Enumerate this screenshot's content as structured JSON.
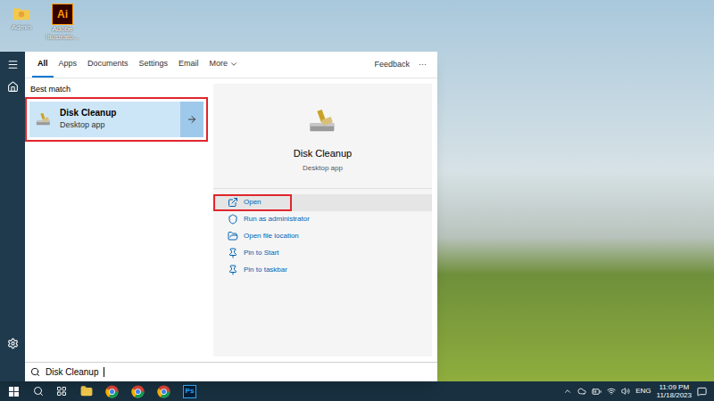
{
  "desktop": {
    "icons": [
      {
        "label": "Admin",
        "kind": "folder"
      },
      {
        "label": "Adobe Illustrato...",
        "kind": "illustrator",
        "badge": "Ai"
      }
    ]
  },
  "search_panel": {
    "tabs": [
      {
        "label": "All",
        "selected": true
      },
      {
        "label": "Apps",
        "selected": false
      },
      {
        "label": "Documents",
        "selected": false
      },
      {
        "label": "Settings",
        "selected": false
      },
      {
        "label": "Email",
        "selected": false
      },
      {
        "label": "More",
        "selected": false
      }
    ],
    "feedback": "Feedback",
    "overflow": "···"
  },
  "best_match": {
    "heading": "Best match",
    "title": "Disk Cleanup",
    "subtitle": "Desktop app",
    "selected": true,
    "annotated": true
  },
  "preview": {
    "title": "Disk Cleanup",
    "subtitle": "Desktop app"
  },
  "actions": [
    {
      "label": "Open",
      "kind": "open",
      "selected": true,
      "annotated": true
    },
    {
      "label": "Run as administrator",
      "kind": "admin",
      "selected": false,
      "annotated": false
    },
    {
      "label": "Open file location",
      "kind": "location",
      "selected": false,
      "annotated": false
    },
    {
      "label": "Pin to Start",
      "kind": "pin",
      "selected": false,
      "annotated": false
    },
    {
      "label": "Pin to taskbar",
      "kind": "pin",
      "selected": false,
      "annotated": false
    }
  ],
  "search": {
    "value": "Disk Cleanup"
  },
  "taskbar": {
    "apps": [
      {
        "kind": "explorer",
        "label": ""
      },
      {
        "kind": "chrome",
        "label": ""
      },
      {
        "kind": "chrome",
        "label": ""
      },
      {
        "kind": "chrome",
        "label": ""
      },
      {
        "kind": "photoshop",
        "label": "Ps"
      }
    ],
    "language": "ENG",
    "time": "11:09 PM",
    "date": "11/18/2023"
  }
}
